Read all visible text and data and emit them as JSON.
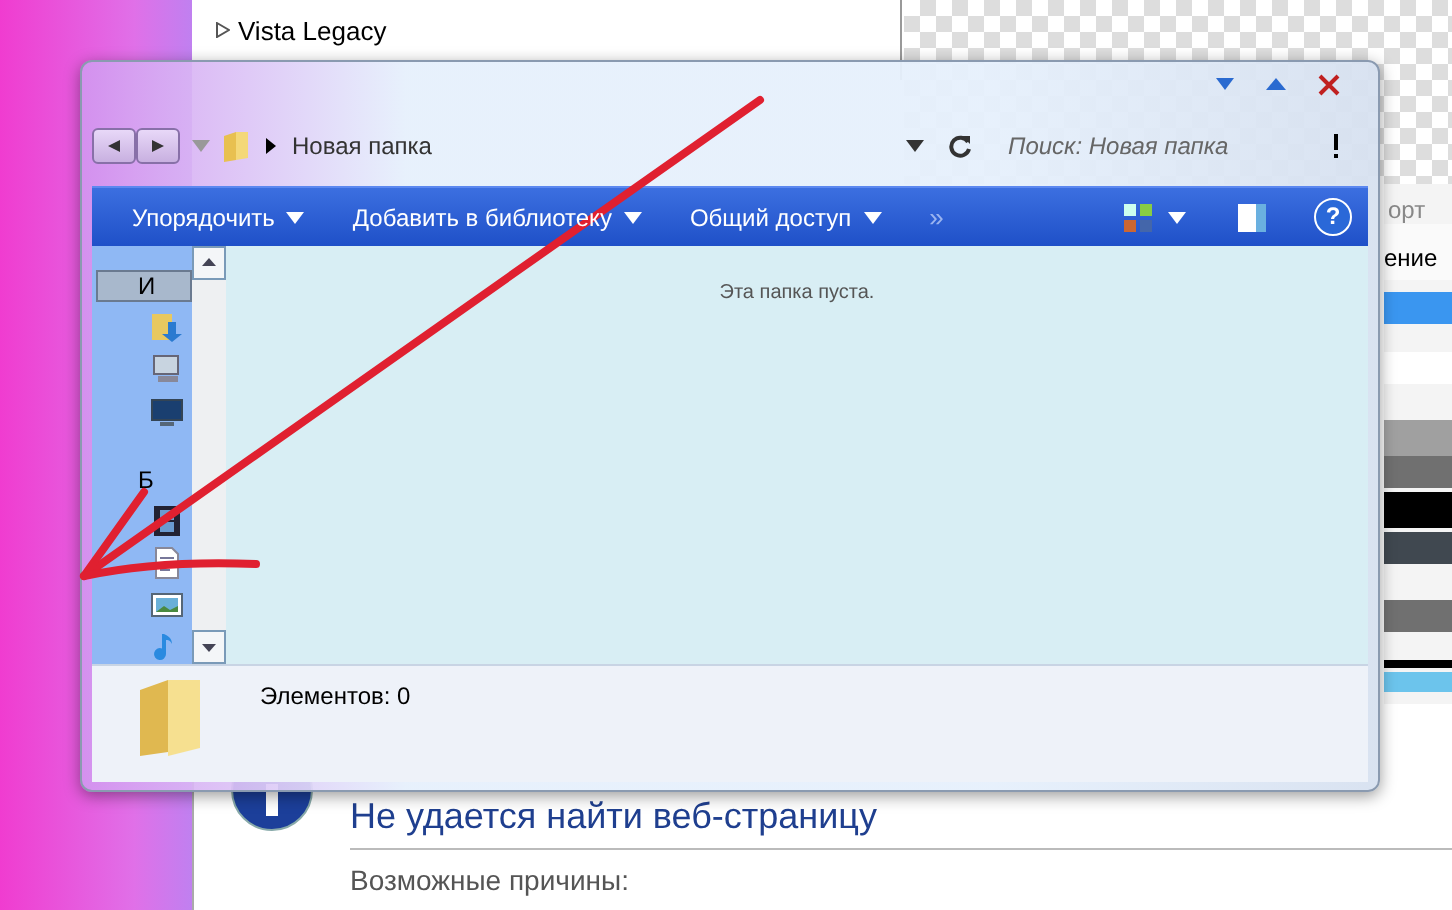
{
  "background_window": {
    "tree_items": [
      {
        "label": "Vista Legacy",
        "expanded": false
      }
    ]
  },
  "right_panel": {
    "toolbar_text": "орт",
    "column_header": "ение"
  },
  "browser_page": {
    "heading": "Не удается найти веб-страницу",
    "subheading": "Возможные причины:"
  },
  "explorer": {
    "breadcrumb": "Новая папка",
    "search": {
      "placeholder": "Поиск: Новая папка"
    },
    "toolbar": [
      {
        "label": "Упорядочить",
        "kind": "menu"
      },
      {
        "label": "Добавить в библиотеку",
        "kind": "menu"
      },
      {
        "label": "Общий доступ",
        "kind": "menu"
      },
      {
        "label": "»",
        "kind": "overflow"
      }
    ],
    "sidebar": [
      {
        "kind": "group",
        "label": "И",
        "selected": true
      },
      {
        "kind": "icon",
        "selected": false
      },
      {
        "kind": "icon",
        "selected": false
      },
      {
        "kind": "icon",
        "selected": false
      },
      {
        "kind": "gap"
      },
      {
        "kind": "group",
        "label": "Б",
        "selected": false
      },
      {
        "kind": "icon",
        "selected": false
      },
      {
        "kind": "icon",
        "selected": false
      },
      {
        "kind": "icon",
        "selected": false
      },
      {
        "kind": "icon",
        "selected": false
      }
    ],
    "help_label": "?",
    "empty_message": "Эта папка пуста.",
    "status": "Элементов: 0"
  }
}
